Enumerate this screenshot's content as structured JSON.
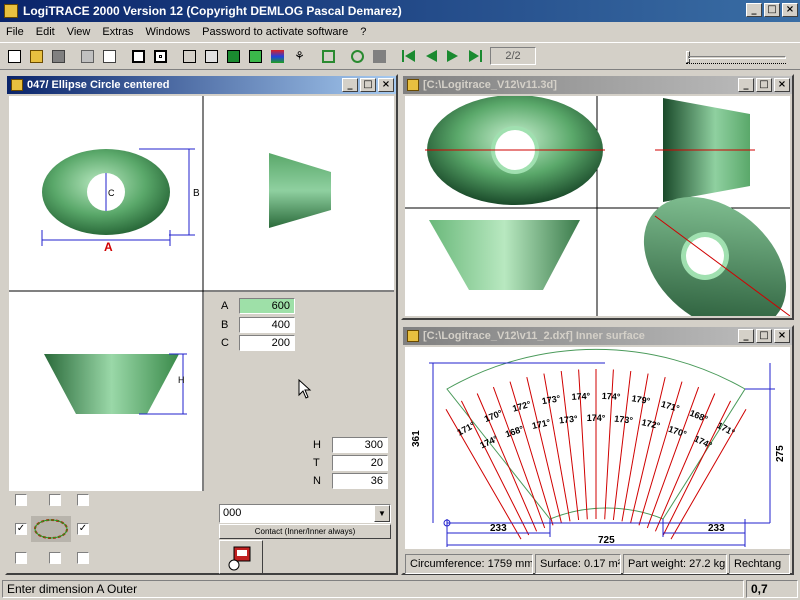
{
  "app": {
    "title": "LogiTRACE 2000  Version 12  (Copyright DEMLOG Pascal Demarez)"
  },
  "menu": [
    "File",
    "Edit",
    "View",
    "Extras",
    "Windows",
    "Password to activate software",
    "?"
  ],
  "toolbar": {
    "page_indicator": "2/2"
  },
  "win_left": {
    "title": "047/ Ellipse Circle centered",
    "labels": {
      "a": "A",
      "b": "B",
      "c": "C",
      "h": "H"
    },
    "dims": [
      {
        "name": "A",
        "value": "600"
      },
      {
        "name": "B",
        "value": "400"
      },
      {
        "name": "C",
        "value": "200"
      }
    ],
    "dims2": [
      {
        "name": "H",
        "value": "300"
      },
      {
        "name": "T",
        "value": "20"
      },
      {
        "name": "N",
        "value": "36"
      }
    ],
    "combo_value": "000",
    "contact_button": "Contact (Inner/Inner always)"
  },
  "win_3d": {
    "title": "[C:\\Logitrace_V12\\v11.3d]"
  },
  "win_dxf": {
    "title": "[C:\\Logitrace_V12\\v11_2.dxf]  Inner surface",
    "angles": [
      "171°",
      "174°",
      "170°",
      "168°",
      "172°",
      "171°",
      "173°",
      "173°",
      "174°",
      "174°",
      "174°",
      "173°",
      "179°",
      "172°",
      "171°",
      "170°",
      "168°",
      "174°",
      "171°"
    ],
    "dims": {
      "height": "361",
      "side": "275",
      "left": "233",
      "right": "233",
      "width": "725"
    },
    "info": {
      "circumference": "Circumference: 1759 mm",
      "surface": "Surface: 0.17 m²",
      "weight": "Part weight: 27.2 kg",
      "shape": "Rechtang"
    }
  },
  "status": {
    "message": "Enter dimension A Outer",
    "value": "0,7"
  }
}
